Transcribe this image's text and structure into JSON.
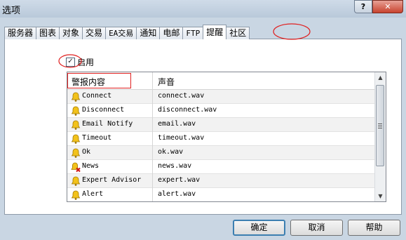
{
  "window": {
    "title": "选项",
    "help_button": "?",
    "close_button": "✕"
  },
  "tabs": [
    {
      "label": "服务器",
      "mono": false
    },
    {
      "label": "图表",
      "mono": false
    },
    {
      "label": "对象",
      "mono": false
    },
    {
      "label": "交易",
      "mono": false
    },
    {
      "label": "EA交易",
      "mono": true
    },
    {
      "label": "通知",
      "mono": false
    },
    {
      "label": "电邮",
      "mono": false
    },
    {
      "label": "FTP",
      "mono": true
    },
    {
      "label": "提醒",
      "mono": false
    },
    {
      "label": "社区",
      "mono": false
    }
  ],
  "active_tab": "提醒",
  "enable": {
    "label": "启用",
    "checked": true
  },
  "table": {
    "col1": "警报内容",
    "col2": "声音",
    "rows": [
      {
        "event": "Connect",
        "sound": "connect.wav",
        "icon": "bell-icon"
      },
      {
        "event": "Disconnect",
        "sound": "disconnect.wav",
        "icon": "bell-icon"
      },
      {
        "event": "Email Notify",
        "sound": "email.wav",
        "icon": "bell-icon"
      },
      {
        "event": "Timeout",
        "sound": "timeout.wav",
        "icon": "bell-icon"
      },
      {
        "event": "Ok",
        "sound": "ok.wav",
        "icon": "bell-icon"
      },
      {
        "event": "News",
        "sound": "news.wav",
        "icon": "bell-disabled-icon"
      },
      {
        "event": "Expert Advisor",
        "sound": "expert.wav",
        "icon": "bell-icon"
      },
      {
        "event": "Alert",
        "sound": "alert.wav",
        "icon": "bell-icon"
      }
    ]
  },
  "buttons": {
    "ok": "确定",
    "cancel": "取消",
    "help": "帮助"
  },
  "colors": {
    "annotation": "#e02020",
    "bell": "#f2c21b",
    "titlebar": "#c4d3e2"
  }
}
